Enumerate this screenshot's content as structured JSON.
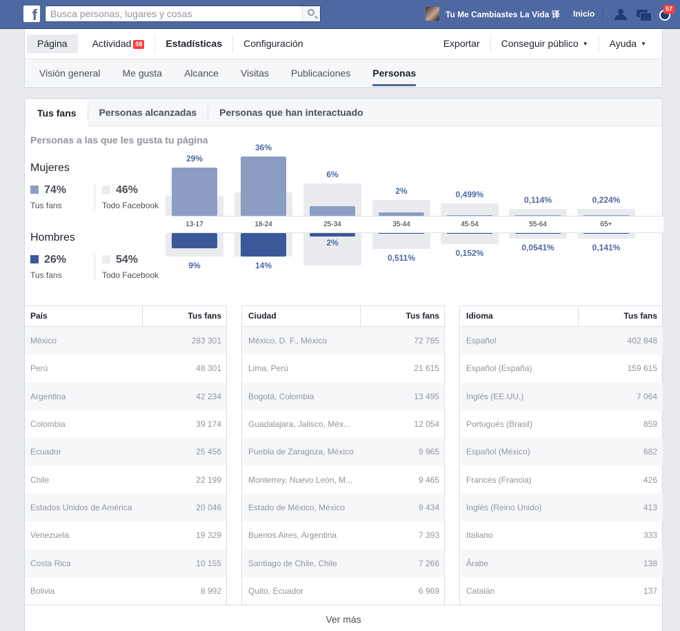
{
  "topbar": {
    "logo": "f",
    "search_placeholder": "Busca personas, lugares y cosas",
    "profile_name": "Tu Me Cambiastes La Vida 译",
    "home_label": "Inicio",
    "notifications_count": "57"
  },
  "page_nav": {
    "items": [
      {
        "label": "Página"
      },
      {
        "label": "Actividad",
        "badge": "58"
      },
      {
        "label": "Estadísticas"
      },
      {
        "label": "Configuración"
      }
    ],
    "right": [
      {
        "label": "Exportar"
      },
      {
        "label": "Conseguir público"
      },
      {
        "label": "Ayuda"
      }
    ]
  },
  "sub_nav": [
    "Visión general",
    "Me gusta",
    "Alcance",
    "Visitas",
    "Publicaciones",
    "Personas"
  ],
  "tabs": [
    "Tus fans",
    "Personas alcanzadas",
    "Personas que han interactuado"
  ],
  "demographics": {
    "title": "Personas a las que les gusta tu página",
    "women": {
      "label": "Mujeres",
      "fans_pct": "74%",
      "fans_label": "Tus fans",
      "fb_pct": "46%",
      "fb_label": "Todo Facebook"
    },
    "men": {
      "label": "Hombres",
      "fans_pct": "26%",
      "fans_label": "Tus fans",
      "fb_pct": "54%",
      "fb_label": "Todo Facebook"
    },
    "colors": {
      "women": "#8b9dc3",
      "men": "#3b5998",
      "facebook": "#e9ebee"
    }
  },
  "chart_data": {
    "type": "bar",
    "categories": [
      "13-17",
      "18-24",
      "25-34",
      "35-44",
      "45-54",
      "55-64",
      "65+"
    ],
    "series": [
      {
        "name": "Mujeres",
        "labels": [
          "29%",
          "36%",
          "6%",
          "2%",
          "0,499%",
          "0,114%",
          "0,224%"
        ],
        "values": [
          29,
          36,
          6,
          2,
          0.499,
          0.114,
          0.224
        ]
      },
      {
        "name": "Hombres",
        "labels": [
          "9%",
          "14%",
          "2%",
          "0,511%",
          "0,152%",
          "0,0541%",
          "0,141%"
        ],
        "values": [
          9,
          14,
          2,
          0.511,
          0.152,
          0.0541,
          0.141
        ]
      }
    ],
    "facebook_women": [
      11,
      13,
      18,
      9,
      7,
      4,
      4
    ],
    "facebook_men": [
      13,
      13,
      18,
      9,
      6,
      3,
      3
    ]
  },
  "tables": [
    {
      "col1": "País",
      "col2": "Tus fans",
      "rows": [
        [
          "México",
          "283 301"
        ],
        [
          "Perú",
          "48 301"
        ],
        [
          "Argentina",
          "42 234"
        ],
        [
          "Colombia",
          "39 174"
        ],
        [
          "Ecuador",
          "25 456"
        ],
        [
          "Chile",
          "22 199"
        ],
        [
          "Estados Unidos de América",
          "20 046"
        ],
        [
          "Venezuela",
          "19 329"
        ],
        [
          "Costa Rica",
          "10 155"
        ],
        [
          "Bolivia",
          "8 992"
        ]
      ]
    },
    {
      "col1": "Ciudad",
      "col2": "Tus fans",
      "rows": [
        [
          "México, D. F., México",
          "72 785"
        ],
        [
          "Lima, Perú",
          "21 615"
        ],
        [
          "Bogotá, Colombia",
          "13 495"
        ],
        [
          "Guadalajara, Jalisco, Méx...",
          "12 054"
        ],
        [
          "Puebla de Zaragoza, México",
          "9 965"
        ],
        [
          "Monterrey, Nuevo León, M...",
          "9 465"
        ],
        [
          "Estado de México, México",
          "9 434"
        ],
        [
          "Buenos Aires, Argentina",
          "7 393"
        ],
        [
          "Santiago de Chile, Chile",
          "7 266"
        ],
        [
          "Quito, Ecuador",
          "6 969"
        ]
      ]
    },
    {
      "col1": "Idioma",
      "col2": "Tus fans",
      "rows": [
        [
          "Español",
          "402 848"
        ],
        [
          "Español (España)",
          "159 615"
        ],
        [
          "Inglés (EE.UU.)",
          "7 064"
        ],
        [
          "Portugués (Brasil)",
          "859"
        ],
        [
          "Español (México)",
          "682"
        ],
        [
          "Francés (Francia)",
          "426"
        ],
        [
          "Inglés (Reino Unido)",
          "413"
        ],
        [
          "Italiano",
          "333"
        ],
        [
          "Árabe",
          "138"
        ],
        [
          "Catalán",
          "137"
        ]
      ]
    }
  ],
  "see_more": "Ver más"
}
